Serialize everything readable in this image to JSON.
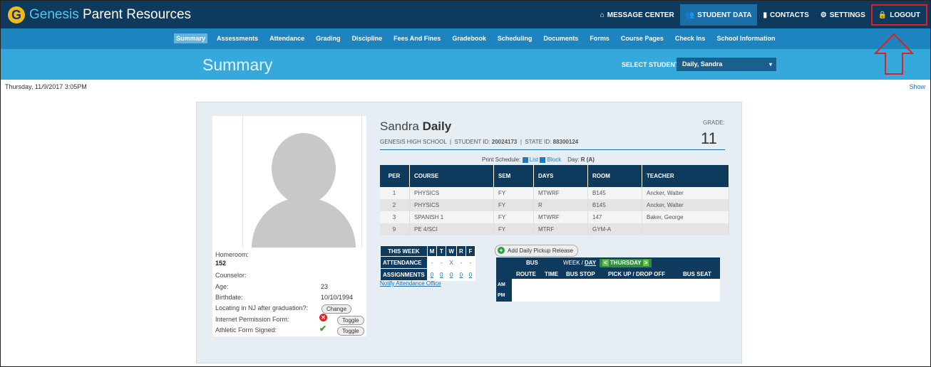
{
  "app": {
    "logo_letter": "G",
    "brand_first": "Genesis",
    "brand_rest": " Parent Resources"
  },
  "topnav": {
    "items": [
      {
        "icon": "home-icon",
        "label": "MESSAGE CENTER"
      },
      {
        "icon": "users-icon",
        "label": "STUDENT DATA",
        "active": true
      },
      {
        "icon": "book-icon",
        "label": "CONTACTS"
      },
      {
        "icon": "gear-icon",
        "label": "SETTINGS"
      },
      {
        "icon": "lock-icon",
        "label": "LOGOUT",
        "highlighted": true
      }
    ]
  },
  "subnav": {
    "items": [
      "Summary",
      "Assessments",
      "Attendance",
      "Grading",
      "Discipline",
      "Fees And Fines",
      "Gradebook",
      "Scheduling",
      "Documents",
      "Forms",
      "Course Pages",
      "Check Ins",
      "School Information"
    ],
    "active": "Summary"
  },
  "titlebar": {
    "title": "Summary",
    "select_label": "SELECT STUDENT:",
    "selected_student": "Daily, Sandra"
  },
  "datetime": "Thursday, 11/9/2017 3:05PM",
  "show_link": "Show",
  "profile": {
    "homeroom_label": "Homeroom:",
    "homeroom_value": "152",
    "counselor_label": "Counselor:",
    "age_label": "Age:",
    "age_value": "23",
    "birthdate_label": "Birthdate:",
    "birthdate_value": "10/10/1994",
    "locating_label": "Locating in NJ after graduation?:",
    "change_label": "Change",
    "internet_label": "Internet Permission Form:",
    "athletic_label": "Athletic Form Signed:",
    "toggle_label": "Toggle"
  },
  "student": {
    "first": "Sandra",
    "last": "Daily",
    "school": "GENESIS HIGH SCHOOL",
    "student_id_label": "STUDENT ID:",
    "student_id": "20024173",
    "state_id_label": "STATE ID:",
    "state_id": "88300124",
    "grade_label": "GRADE:",
    "grade": "11"
  },
  "print_schedule": {
    "label": "Print Schedule:",
    "list": "List",
    "block": "Block",
    "day_label": "Day:",
    "day_value": "R (A)"
  },
  "schedule": {
    "headers": [
      "PER",
      "COURSE",
      "SEM",
      "DAYS",
      "ROOM",
      "TEACHER"
    ],
    "rows": [
      [
        "1",
        "PHYSICS",
        "FY",
        "MTWRF",
        "B145",
        "Ancker, Walter"
      ],
      [
        "2",
        "PHYSICS",
        "FY",
        "R",
        "B145",
        "Ancker, Walter"
      ],
      [
        "3",
        "SPANISH 1",
        "FY",
        "MTWRF",
        "147",
        "Baker, George"
      ],
      [
        "9",
        "PE 4/SCI",
        "FY",
        "MTRF",
        "GYM-A",
        ""
      ]
    ]
  },
  "week": {
    "title": "THIS WEEK",
    "days": [
      "M",
      "T",
      "W",
      "R",
      "F"
    ],
    "attendance_label": "ATTENDANCE",
    "attendance": [
      "-",
      "-",
      "X",
      "-",
      "-"
    ],
    "assignments_label": "ASSIGNMENTS",
    "assignments": [
      "0",
      "0",
      "0",
      "0",
      "0"
    ],
    "notify": "Notify Attendance Office"
  },
  "bus": {
    "add_pickup": "Add Daily Pickup Release",
    "title": "BUS",
    "week": "WEEK /",
    "day": "DAY",
    "day_name": "THURSDAY",
    "columns": [
      "ROUTE",
      "TIME",
      "BUS STOP",
      "PICK UP / DROP OFF",
      "BUS SEAT"
    ],
    "am": "AM",
    "pm": "PM"
  }
}
